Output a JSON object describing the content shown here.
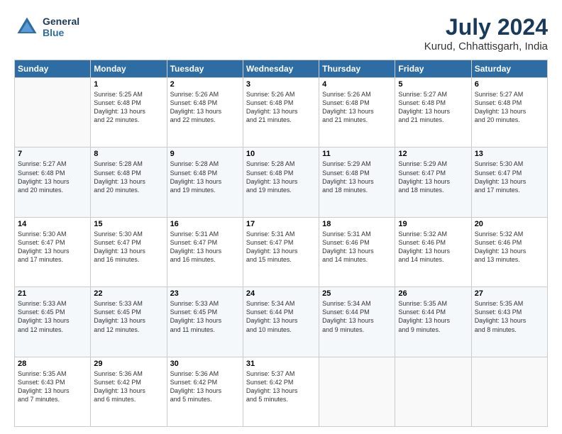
{
  "header": {
    "logo_line1": "General",
    "logo_line2": "Blue",
    "month_year": "July 2024",
    "location": "Kurud, Chhattisgarh, India"
  },
  "weekdays": [
    "Sunday",
    "Monday",
    "Tuesday",
    "Wednesday",
    "Thursday",
    "Friday",
    "Saturday"
  ],
  "weeks": [
    [
      {
        "day": "",
        "info": ""
      },
      {
        "day": "1",
        "info": "Sunrise: 5:25 AM\nSunset: 6:48 PM\nDaylight: 13 hours\nand 22 minutes."
      },
      {
        "day": "2",
        "info": "Sunrise: 5:26 AM\nSunset: 6:48 PM\nDaylight: 13 hours\nand 22 minutes."
      },
      {
        "day": "3",
        "info": "Sunrise: 5:26 AM\nSunset: 6:48 PM\nDaylight: 13 hours\nand 21 minutes."
      },
      {
        "day": "4",
        "info": "Sunrise: 5:26 AM\nSunset: 6:48 PM\nDaylight: 13 hours\nand 21 minutes."
      },
      {
        "day": "5",
        "info": "Sunrise: 5:27 AM\nSunset: 6:48 PM\nDaylight: 13 hours\nand 21 minutes."
      },
      {
        "day": "6",
        "info": "Sunrise: 5:27 AM\nSunset: 6:48 PM\nDaylight: 13 hours\nand 20 minutes."
      }
    ],
    [
      {
        "day": "7",
        "info": "Sunrise: 5:27 AM\nSunset: 6:48 PM\nDaylight: 13 hours\nand 20 minutes."
      },
      {
        "day": "8",
        "info": "Sunrise: 5:28 AM\nSunset: 6:48 PM\nDaylight: 13 hours\nand 20 minutes."
      },
      {
        "day": "9",
        "info": "Sunrise: 5:28 AM\nSunset: 6:48 PM\nDaylight: 13 hours\nand 19 minutes."
      },
      {
        "day": "10",
        "info": "Sunrise: 5:28 AM\nSunset: 6:48 PM\nDaylight: 13 hours\nand 19 minutes."
      },
      {
        "day": "11",
        "info": "Sunrise: 5:29 AM\nSunset: 6:48 PM\nDaylight: 13 hours\nand 18 minutes."
      },
      {
        "day": "12",
        "info": "Sunrise: 5:29 AM\nSunset: 6:47 PM\nDaylight: 13 hours\nand 18 minutes."
      },
      {
        "day": "13",
        "info": "Sunrise: 5:30 AM\nSunset: 6:47 PM\nDaylight: 13 hours\nand 17 minutes."
      }
    ],
    [
      {
        "day": "14",
        "info": "Sunrise: 5:30 AM\nSunset: 6:47 PM\nDaylight: 13 hours\nand 17 minutes."
      },
      {
        "day": "15",
        "info": "Sunrise: 5:30 AM\nSunset: 6:47 PM\nDaylight: 13 hours\nand 16 minutes."
      },
      {
        "day": "16",
        "info": "Sunrise: 5:31 AM\nSunset: 6:47 PM\nDaylight: 13 hours\nand 16 minutes."
      },
      {
        "day": "17",
        "info": "Sunrise: 5:31 AM\nSunset: 6:47 PM\nDaylight: 13 hours\nand 15 minutes."
      },
      {
        "day": "18",
        "info": "Sunrise: 5:31 AM\nSunset: 6:46 PM\nDaylight: 13 hours\nand 14 minutes."
      },
      {
        "day": "19",
        "info": "Sunrise: 5:32 AM\nSunset: 6:46 PM\nDaylight: 13 hours\nand 14 minutes."
      },
      {
        "day": "20",
        "info": "Sunrise: 5:32 AM\nSunset: 6:46 PM\nDaylight: 13 hours\nand 13 minutes."
      }
    ],
    [
      {
        "day": "21",
        "info": "Sunrise: 5:33 AM\nSunset: 6:45 PM\nDaylight: 13 hours\nand 12 minutes."
      },
      {
        "day": "22",
        "info": "Sunrise: 5:33 AM\nSunset: 6:45 PM\nDaylight: 13 hours\nand 12 minutes."
      },
      {
        "day": "23",
        "info": "Sunrise: 5:33 AM\nSunset: 6:45 PM\nDaylight: 13 hours\nand 11 minutes."
      },
      {
        "day": "24",
        "info": "Sunrise: 5:34 AM\nSunset: 6:44 PM\nDaylight: 13 hours\nand 10 minutes."
      },
      {
        "day": "25",
        "info": "Sunrise: 5:34 AM\nSunset: 6:44 PM\nDaylight: 13 hours\nand 9 minutes."
      },
      {
        "day": "26",
        "info": "Sunrise: 5:35 AM\nSunset: 6:44 PM\nDaylight: 13 hours\nand 9 minutes."
      },
      {
        "day": "27",
        "info": "Sunrise: 5:35 AM\nSunset: 6:43 PM\nDaylight: 13 hours\nand 8 minutes."
      }
    ],
    [
      {
        "day": "28",
        "info": "Sunrise: 5:35 AM\nSunset: 6:43 PM\nDaylight: 13 hours\nand 7 minutes."
      },
      {
        "day": "29",
        "info": "Sunrise: 5:36 AM\nSunset: 6:42 PM\nDaylight: 13 hours\nand 6 minutes."
      },
      {
        "day": "30",
        "info": "Sunrise: 5:36 AM\nSunset: 6:42 PM\nDaylight: 13 hours\nand 5 minutes."
      },
      {
        "day": "31",
        "info": "Sunrise: 5:37 AM\nSunset: 6:42 PM\nDaylight: 13 hours\nand 5 minutes."
      },
      {
        "day": "",
        "info": ""
      },
      {
        "day": "",
        "info": ""
      },
      {
        "day": "",
        "info": ""
      }
    ]
  ]
}
